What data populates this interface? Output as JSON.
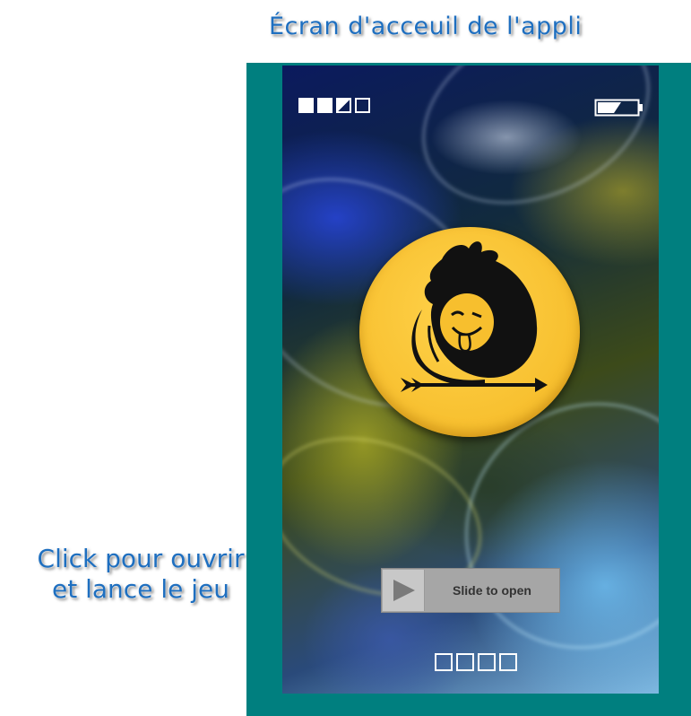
{
  "header": {
    "title": "Écran d'acceuil de l'appli"
  },
  "annotation": {
    "line1": "Click pour ouvrir",
    "line2": "et lance le jeu"
  },
  "status_bar": {
    "signal_bars": [
      "full",
      "full",
      "half",
      "empty"
    ],
    "battery_level": 0.6
  },
  "slider": {
    "label": "Slide to open",
    "icon": "play-triangle-icon"
  },
  "page_indicator": {
    "count": 4
  },
  "colors": {
    "device_frame": "#007f7f",
    "caption": "#1e6fc0",
    "logo_badge": "#f7bf2e",
    "slider_bg": "#a6a6a6"
  }
}
